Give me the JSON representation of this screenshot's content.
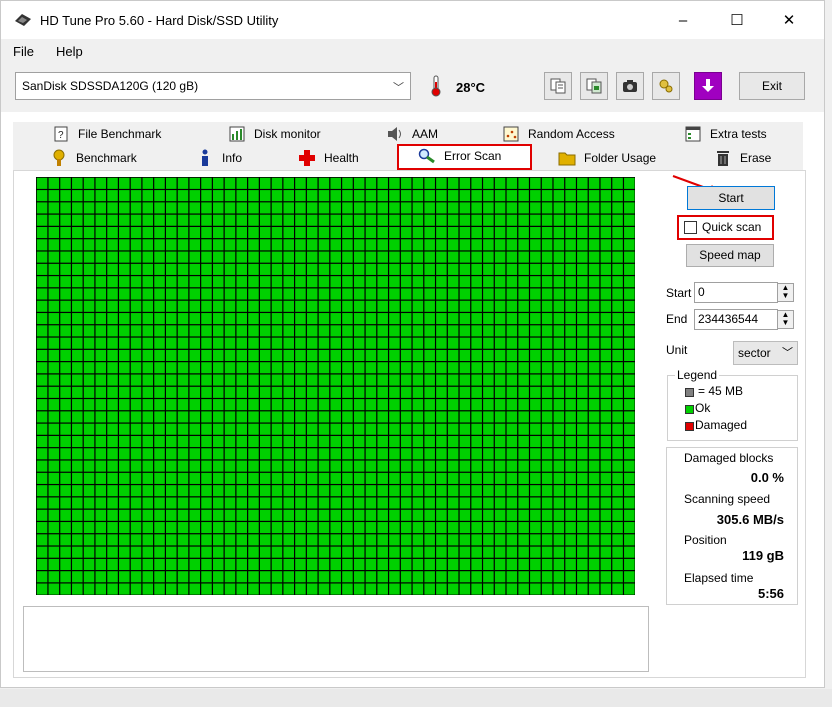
{
  "window": {
    "title": "HD Tune Pro 5.60 - Hard Disk/SSD Utility",
    "minimize": "–",
    "maximize": "☐",
    "close": "✕"
  },
  "menu": {
    "file": "File",
    "help": "Help"
  },
  "toolbar": {
    "drive": "SanDisk SDSSDA120G (120 gB)",
    "temperature": "28°C",
    "exit_label": "Exit"
  },
  "tabs": {
    "row1": [
      "File Benchmark",
      "Disk monitor",
      "AAM",
      "Random Access",
      "Extra tests"
    ],
    "row2": [
      "Benchmark",
      "Info",
      "Health",
      "Error Scan",
      "Folder Usage",
      "Erase"
    ],
    "active": "Error Scan"
  },
  "block_map": {
    "columns": 51,
    "rows": 34,
    "status": "Ok",
    "color": "#00d000"
  },
  "controls": {
    "start_button": "Start",
    "quick_scan_label": "Quick scan",
    "quick_scan_checked": false,
    "speed_map_button": "Speed map",
    "start_label": "Start",
    "start_value": "0",
    "end_label": "End",
    "end_value": "234436544",
    "unit_label": "Unit",
    "unit_value": "sector"
  },
  "legend": {
    "title": "Legend",
    "items": [
      {
        "label": "= 45 MB",
        "color": "#808080"
      },
      {
        "label": "Ok",
        "color": "#00d000"
      },
      {
        "label": "Damaged",
        "color": "#e00000"
      }
    ]
  },
  "stats": {
    "damaged_blocks_label": "Damaged blocks",
    "damaged_blocks_value": "0.0 %",
    "scanning_speed_label": "Scanning speed",
    "scanning_speed_value": "305.6 MB/s",
    "position_label": "Position",
    "position_value": "119 gB",
    "elapsed_label": "Elapsed time",
    "elapsed_value": "5:56"
  },
  "colors": {
    "highlight": "#e00000",
    "ok": "#00d000",
    "grid": "#000000"
  }
}
